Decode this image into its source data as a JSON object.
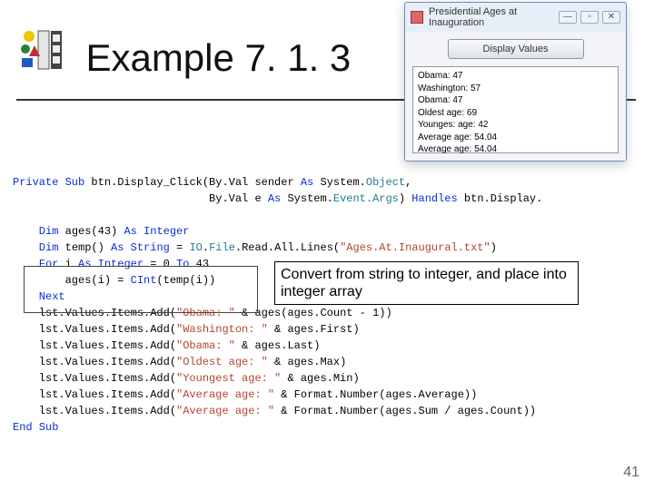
{
  "header": {
    "title": "Example 7. 1. 3"
  },
  "vbwin": {
    "title": "Presidential Ages at Inauguration",
    "button_label": "Display Values",
    "list_items": [
      "Obama: 47",
      "Washington: 57",
      "Obama: 47",
      "Oldest age: 69",
      "Younges: age: 42",
      "Average age: 54.04",
      "Average age: 54.04"
    ],
    "sys": {
      "min": "—",
      "max": "▫",
      "close": "✕"
    }
  },
  "annot": "Convert from string to integer, and place into integer array",
  "page_number": "41",
  "code": {
    "l1a": "Private Sub",
    "l1b": " btn.Display_Click(By.Val sender ",
    "l1c": "As",
    "l1d": " System.",
    "l1e": "Object",
    "l1f": ",",
    "l2a": "                              By.Val e ",
    "l2b": "As",
    "l2c": " System.",
    "l2d": "Event.Args",
    "l2e": ") ",
    "l2f": "Handles",
    "l2g": " btn.Display.",
    "l3a": "    Dim",
    "l3b": " ages(43) ",
    "l3c": "As Integer",
    "l4a": "    Dim",
    "l4b": " temp() ",
    "l4c": "As String",
    "l4d": " = ",
    "l4e": "IO",
    "l4f": ".",
    "l4g": "File",
    "l4h": ".Read.All.Lines(",
    "l4i": "\"Ages.At.Inaugural.txt\"",
    "l4j": ")",
    "l5a": "    For",
    "l5b": " i ",
    "l5c": "As Integer",
    "l5d": " = 0 ",
    "l5e": "To",
    "l5f": " 43",
    "l6a": "        ages(i) = ",
    "l6b": "CInt",
    "l6c": "(temp(i))",
    "l7a": "    Next",
    "l8a": "    lst.Values.Items.Add(",
    "l8b": "\"Obama: \"",
    "l8c": " & ages(ages.Count - 1))",
    "l9a": "    lst.Values.Items.Add(",
    "l9b": "\"Washington: \"",
    "l9c": " & ages.First)",
    "l10a": "    lst.Values.Items.Add(",
    "l10b": "\"Obama: \"",
    "l10c": " & ages.Last)",
    "l11a": "    lst.Values.Items.Add(",
    "l11b": "\"Oldest age: \"",
    "l11c": " & ages.Max)",
    "l12a": "    lst.Values.Items.Add(",
    "l12b": "\"Youngest age: \"",
    "l12c": " & ages.Min)",
    "l13a": "    lst.Values.Items.Add(",
    "l13b": "\"Average age: \"",
    "l13c": " & Format.Number(ages.Average))",
    "l14a": "    lst.Values.Items.Add(",
    "l14b": "\"Average age: \"",
    "l14c": " & Format.Number(ages.Sum / ages.Count))",
    "l15a": "End Sub"
  }
}
